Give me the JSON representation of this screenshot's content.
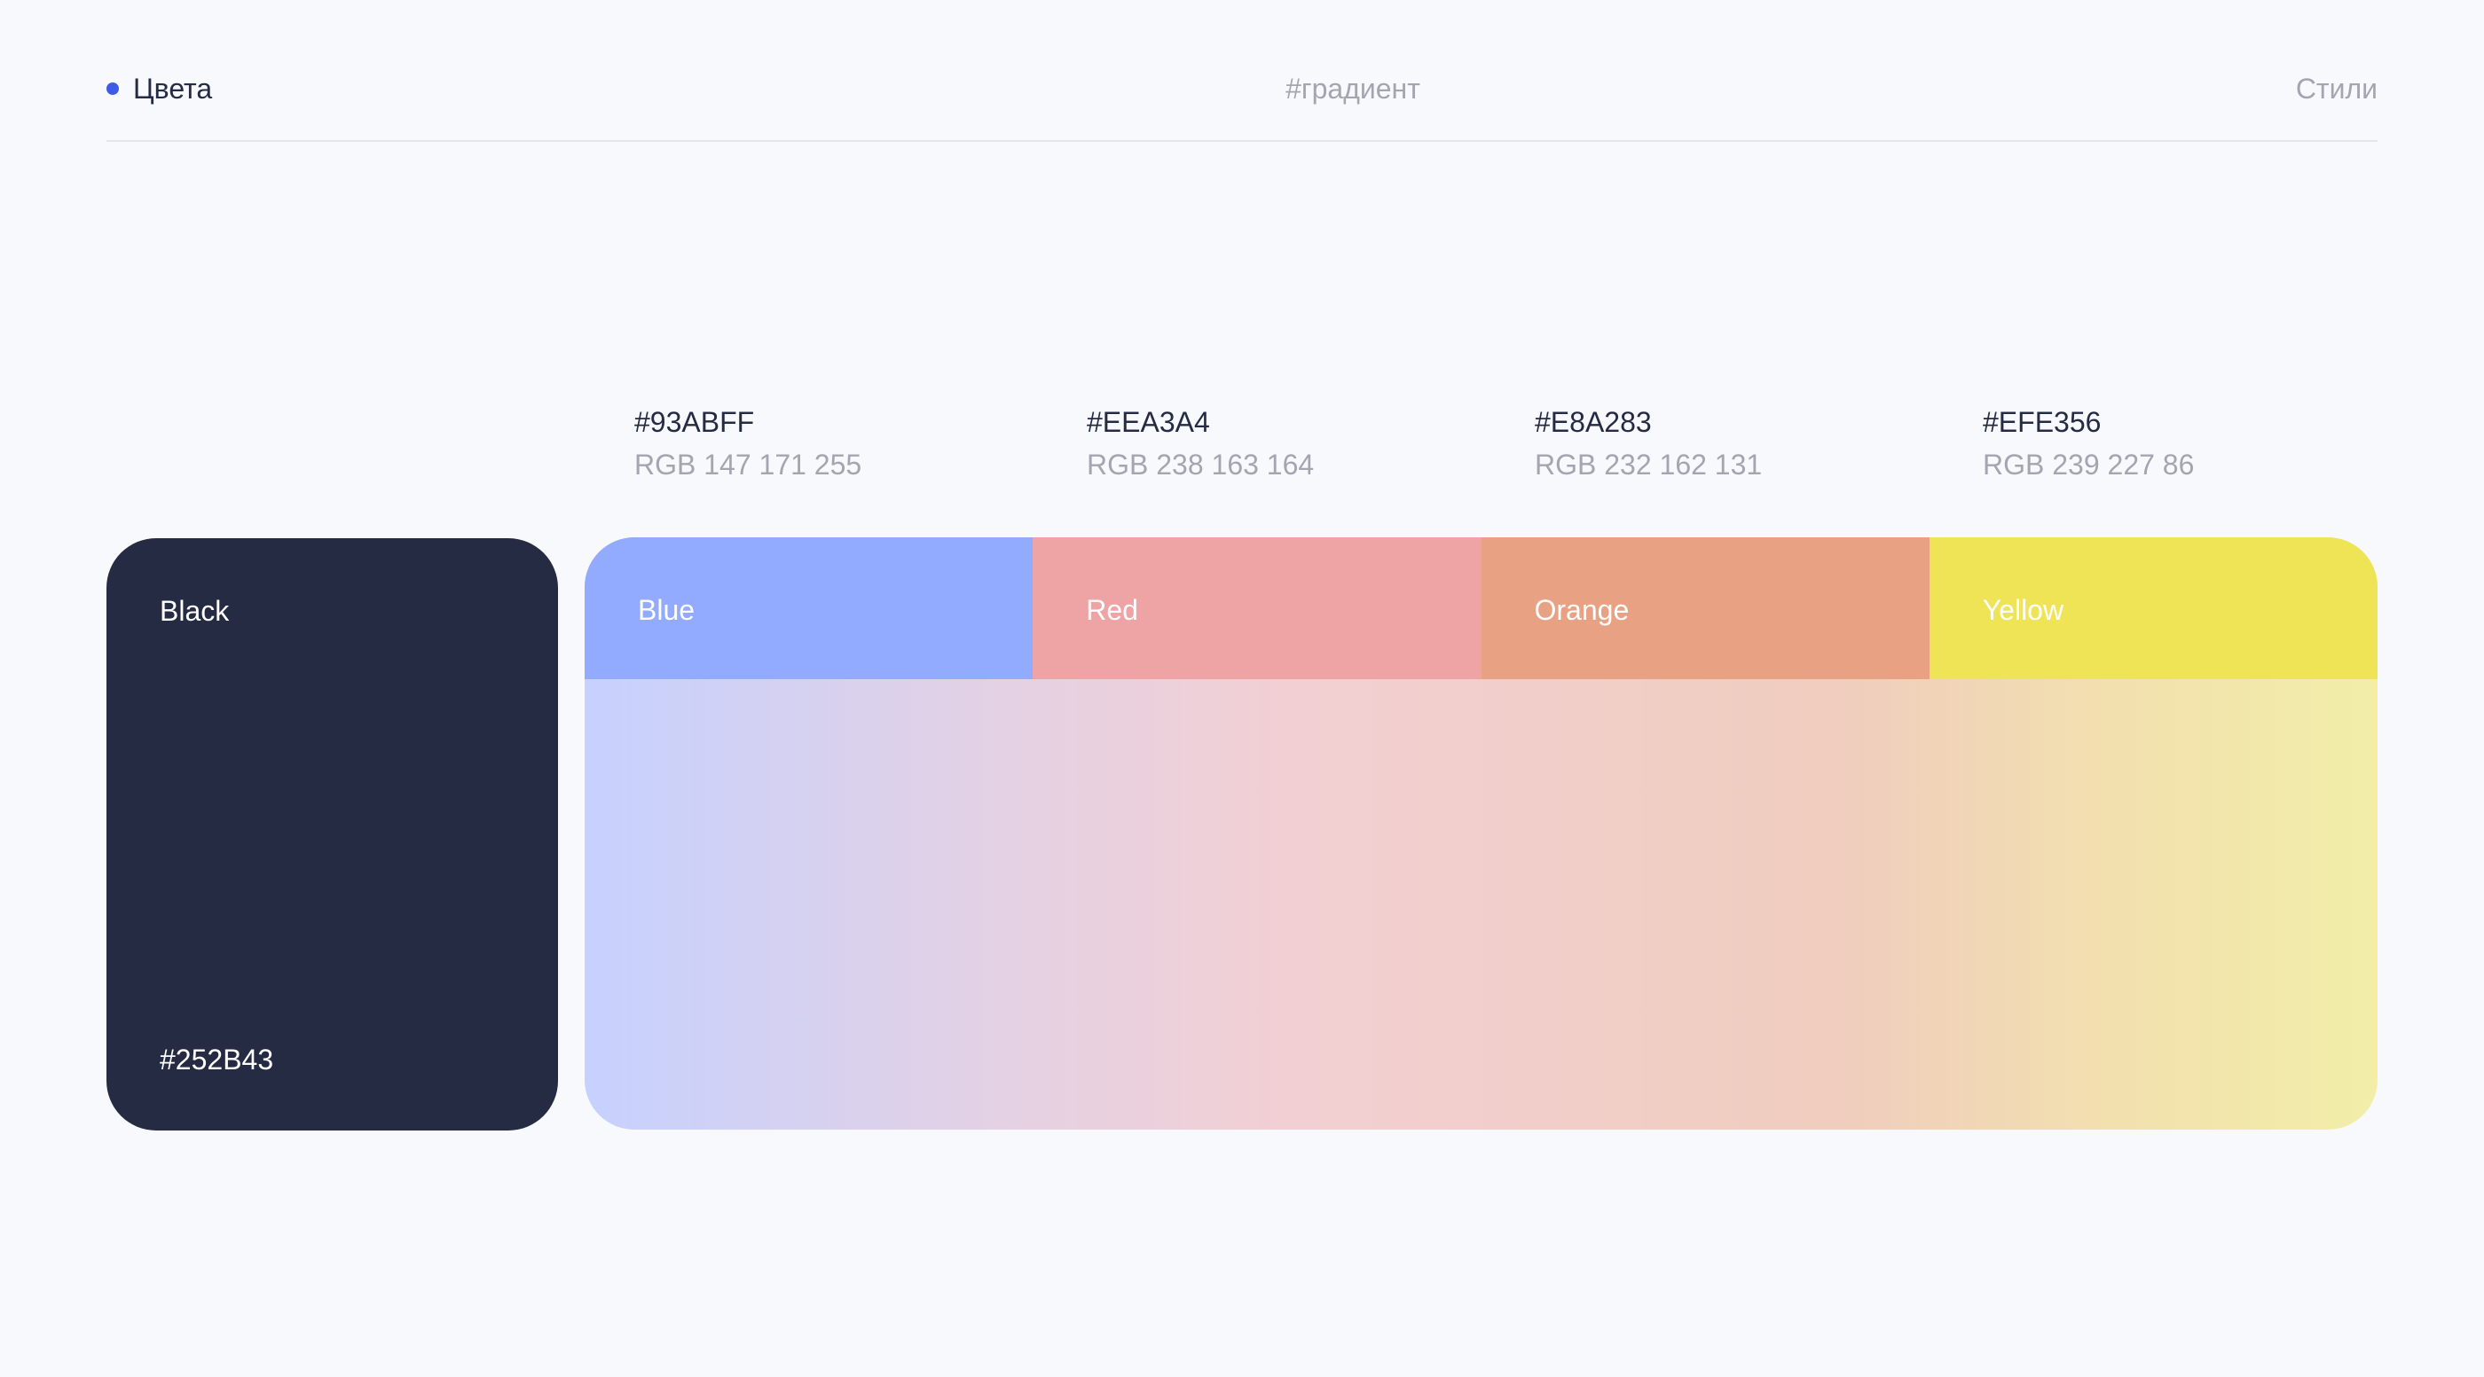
{
  "header": {
    "title": "Цвета",
    "center": "#градиент",
    "right": "Стили",
    "accent_color": "#3D5BE8"
  },
  "black": {
    "name": "Black",
    "hex": "#252B43",
    "color": "#252B43"
  },
  "swatches": [
    {
      "name": "Blue",
      "hex": "#93ABFF",
      "rgb": "RGB 147 171 255",
      "color": "#93ABFF"
    },
    {
      "name": "Red",
      "hex": "#EEA3A4",
      "rgb": "RGB 238 163 164",
      "color": "#EEA3A4"
    },
    {
      "name": "Orange",
      "hex": "#E8A283",
      "rgb": "RGB 232 162 131",
      "color": "#E8A283"
    },
    {
      "name": "Yellow",
      "hex": "#EFE356",
      "rgb": "RGB 239 227 86",
      "color": "#EFE356"
    }
  ]
}
